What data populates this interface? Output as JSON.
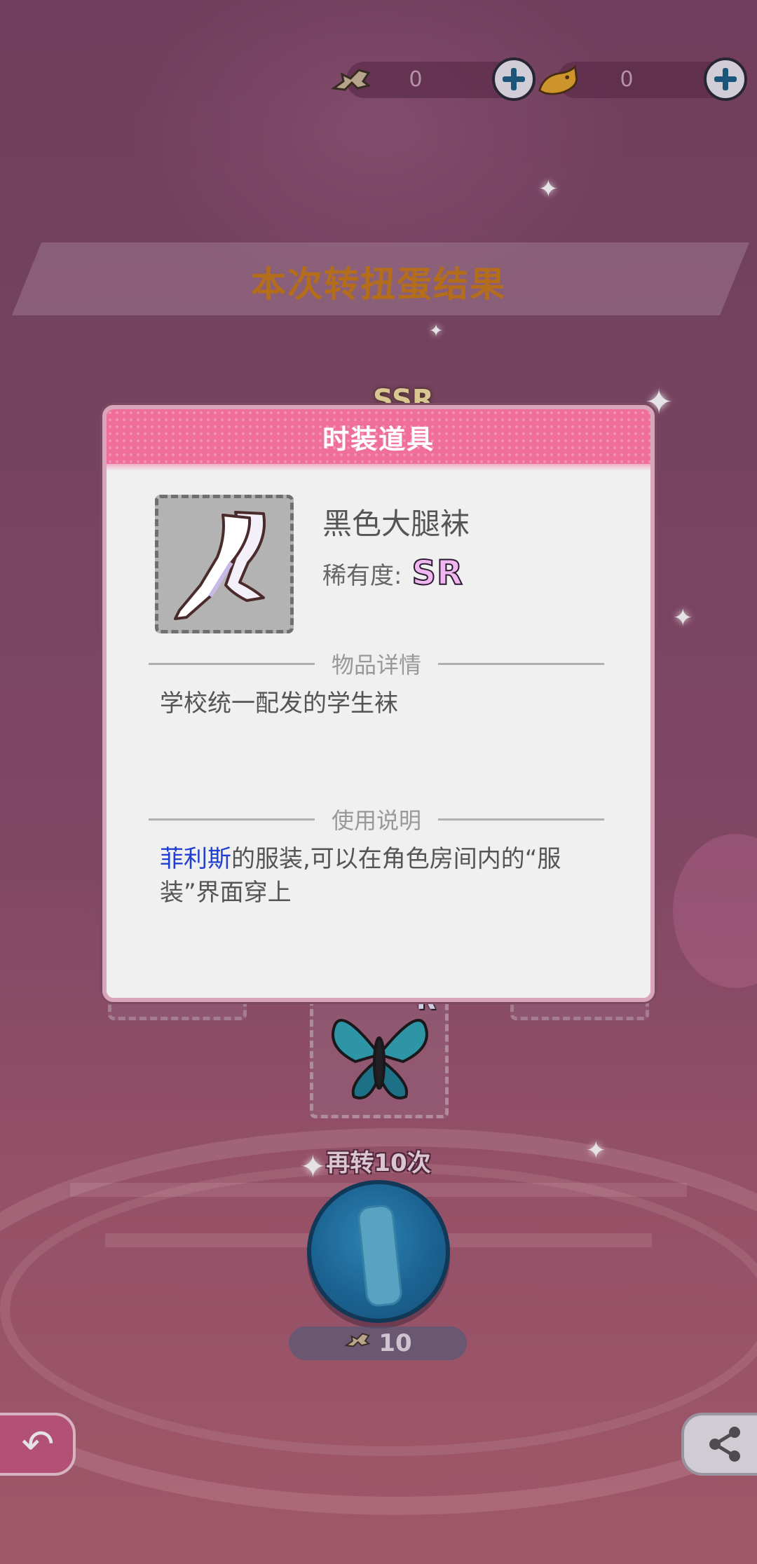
{
  "currency": {
    "fish_bones": {
      "icon": "fishbone-icon",
      "value": "0"
    },
    "fish": {
      "icon": "fish-icon",
      "value": "0"
    }
  },
  "banner": {
    "title": "本次转扭蛋结果"
  },
  "hidden_cards": {
    "top_card_rarity": "SSR",
    "butterfly_card_rarity": "R"
  },
  "spin": {
    "label": "再转10次",
    "cost": "10",
    "cost_icon": "fishbone-icon"
  },
  "modal": {
    "header": "时装道具",
    "item_name": "黑色大腿袜",
    "rarity_label": "稀有度:",
    "rarity_value": "SR",
    "details_heading": "物品详情",
    "details_text": "学校统一配发的学生袜",
    "usage_heading": "使用说明",
    "usage_character": "菲利斯",
    "usage_text": "的服装,可以在角色房间内的“服装”界面穿上"
  },
  "colors": {
    "header_pink": "#ef6f9a",
    "banner_text": "#c77a1a",
    "character_link": "#1e3fd1",
    "spin_button": "#1a6fa0"
  }
}
